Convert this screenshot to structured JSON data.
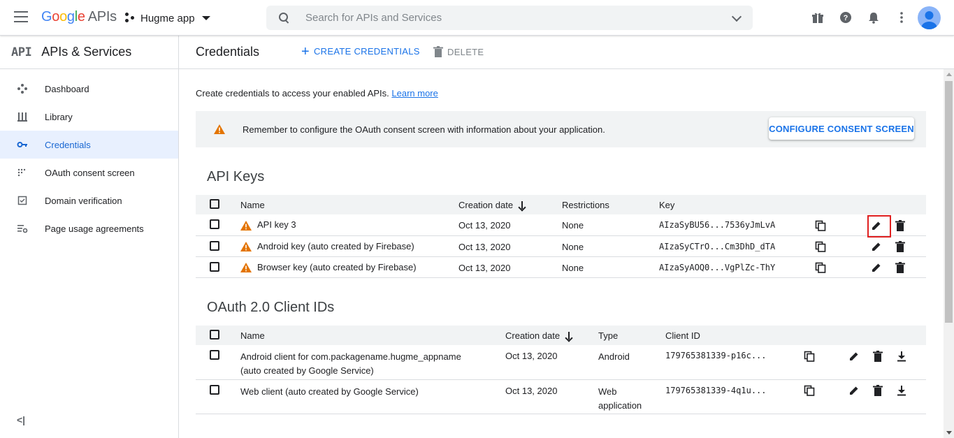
{
  "topbar": {
    "logo_google": [
      "G",
      "o",
      "o",
      "g",
      "l",
      "e"
    ],
    "logo_apis": "APIs",
    "project_name": "Hugme app",
    "search_placeholder": "Search for APIs and Services"
  },
  "sidebar": {
    "logo": "API",
    "title": "APIs & Services",
    "items": [
      {
        "label": "Dashboard",
        "icon": "dashboard-icon",
        "active": false
      },
      {
        "label": "Library",
        "icon": "library-icon",
        "active": false
      },
      {
        "label": "Credentials",
        "icon": "key-icon",
        "active": true
      },
      {
        "label": "OAuth consent screen",
        "icon": "consent-icon",
        "active": false
      },
      {
        "label": "Domain verification",
        "icon": "checkbox-icon",
        "active": false
      },
      {
        "label": "Page usage agreements",
        "icon": "settings-list-icon",
        "active": false
      }
    ],
    "collapse": "<|"
  },
  "header": {
    "title": "Credentials",
    "create_label": "CREATE CREDENTIALS",
    "delete_label": "DELETE"
  },
  "intro": {
    "text": "Create credentials to access your enabled APIs.",
    "link": "Learn more"
  },
  "banner": {
    "message": "Remember to configure the OAuth consent screen with information about your application.",
    "button": "CONFIGURE CONSENT SCREEN"
  },
  "api_keys": {
    "title": "API Keys",
    "columns": {
      "name": "Name",
      "date": "Creation date",
      "restrictions": "Restrictions",
      "key": "Key"
    },
    "rows": [
      {
        "name": "API key 3",
        "date": "Oct 13, 2020",
        "restrictions": "None",
        "key": "AIzaSyBU56...7536yJmLvA"
      },
      {
        "name": "Android key (auto created by Firebase)",
        "date": "Oct 13, 2020",
        "restrictions": "None",
        "key": "AIzaSyCTrO...Cm3DhD_dTA"
      },
      {
        "name": "Browser key (auto created by Firebase)",
        "date": "Oct 13, 2020",
        "restrictions": "None",
        "key": "AIzaSyAOQ0...VgPlZc-ThY"
      }
    ]
  },
  "oauth": {
    "title": "OAuth 2.0 Client IDs",
    "columns": {
      "name": "Name",
      "date": "Creation date",
      "type": "Type",
      "client_id": "Client ID"
    },
    "rows": [
      {
        "name_line1": "Android client for com.packagename.hugme_appname",
        "name_line2": "(auto created by Google Service)",
        "date": "Oct 13, 2020",
        "type_line1": "Android",
        "type_line2": "",
        "client_id": "179765381339-p16c..."
      },
      {
        "name_line1": "Web client (auto created by Google Service)",
        "name_line2": "",
        "date": "Oct 13, 2020",
        "type_line1": "Web",
        "type_line2": "application",
        "client_id": "179765381339-4q1u..."
      }
    ]
  },
  "colors": {
    "accent": "#1a73e8",
    "warning": "#e37400",
    "highlight": "#e02020",
    "active_bg": "#e8f0fe"
  }
}
